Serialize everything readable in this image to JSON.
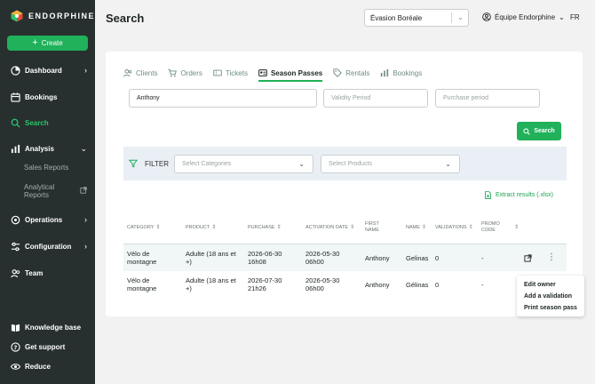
{
  "app": {
    "brand": "ENDORPHINE",
    "brand_colors": {
      "sidebar": "#27302f",
      "accent": "#20b15a",
      "active_nav": "#2cc36b"
    }
  },
  "sidebar": {
    "create_label": "Create",
    "items": [
      {
        "label": "Dashboard",
        "icon": "dashboard-icon",
        "has_chevron": true
      },
      {
        "label": "Bookings",
        "icon": "calendar-icon"
      },
      {
        "label": "Search",
        "icon": "search-icon",
        "active": true
      },
      {
        "label": "Analysis",
        "icon": "chart-icon",
        "expanded": true
      },
      {
        "label": "Operations",
        "icon": "gear-icon",
        "has_chevron": true
      },
      {
        "label": "Configuration",
        "icon": "sliders-icon",
        "has_chevron": true
      },
      {
        "label": "Team",
        "icon": "users-icon"
      }
    ],
    "analysis_sub": [
      "Sales Reports",
      "Analytical Reports"
    ],
    "bottom": [
      {
        "label": "Knowledge base",
        "icon": "book-icon"
      },
      {
        "label": "Get support",
        "icon": "help-icon"
      },
      {
        "label": "Reduce",
        "icon": "eye-icon"
      }
    ]
  },
  "header": {
    "title": "Search",
    "location_select": "Évasion Boréale",
    "team": "Équipe Endorphine",
    "lang": "FR"
  },
  "tabs": [
    {
      "label": "Clients",
      "icon": "users-icon"
    },
    {
      "label": "Orders",
      "icon": "cart-icon"
    },
    {
      "label": "Tickets",
      "icon": "ticket-icon"
    },
    {
      "label": "Season Passes",
      "icon": "pass-icon",
      "active": true
    },
    {
      "label": "Rentals",
      "icon": "tag-icon"
    },
    {
      "label": "Bookings",
      "icon": "chart-icon"
    }
  ],
  "search": {
    "name_value": "Anthony",
    "validity_placeholder": "Validity Period",
    "purchase_placeholder": "Purchase period",
    "button_label": "Search"
  },
  "filter": {
    "label": "FILTER",
    "categories_placeholder": "Select Categories",
    "products_placeholder": "Select Products"
  },
  "extract_label": "Extract results (.xlsx)",
  "table": {
    "headers": [
      "CATEGORY",
      "PRODUCT",
      "PURCHASE",
      "ACTIVATION DATE",
      "FIRST NAME",
      "NAME",
      "VALIDATIONS",
      "PROMO CODE"
    ],
    "rows": [
      {
        "category": "Vélo de montagne",
        "product": "Adulte (18 ans et +)",
        "purchase": "2026-06-30 16h08",
        "activation": "2026-05-30 06h00",
        "first_name": "Anthony",
        "name": "Gelinas",
        "validations": "0",
        "promo": "-"
      },
      {
        "category": "Vélo de montagne",
        "product": "Adulte (18 ans et +)",
        "purchase": "2026-07-30 21h26",
        "activation": "2026-05-30 06h00",
        "first_name": "Anthony",
        "name": "Gélinas",
        "validations": "0",
        "promo": "-"
      }
    ]
  },
  "row_menu": [
    "Edit owner",
    "Add a validation",
    "Print season pass"
  ]
}
